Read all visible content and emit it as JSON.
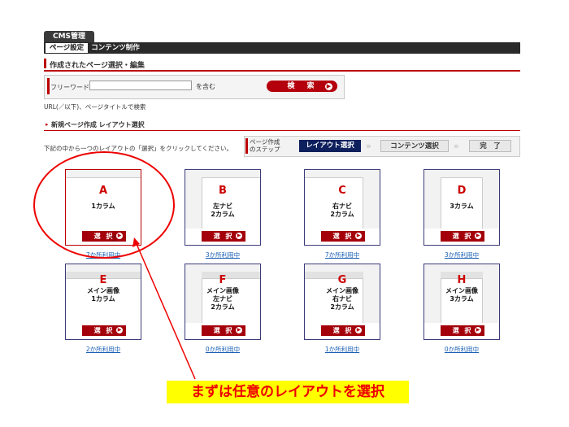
{
  "header": {
    "app_tab": "CMS管理",
    "subtabs": [
      "ページ設定",
      "コンテンツ制作"
    ]
  },
  "section1": {
    "title": "作成されたページ選択・編集"
  },
  "search": {
    "label": "フリーワード",
    "value": "",
    "suffix": "を含む",
    "button": "検　索",
    "hint": "URL(／以下)、ページタイトルで検索"
  },
  "section2": {
    "title": "新規ページ作成 レイアウト選択"
  },
  "instruction": "下記の中から一つのレイアウトの「選択」をクリックしてください。",
  "steps": {
    "label_line1": "ページ作成",
    "label_line2": "のステップ",
    "items": [
      "レイアウト選択",
      "コンテンツ選択",
      "完　了"
    ]
  },
  "layouts": [
    {
      "letter": "A",
      "desc": "1カラム",
      "button": "選 択",
      "usage": "7か所利用中"
    },
    {
      "letter": "B",
      "desc": "左ナビ\n2カラム",
      "button": "選 択",
      "usage": "3か所利用中"
    },
    {
      "letter": "C",
      "desc": "右ナビ\n2カラム",
      "button": "選 択",
      "usage": "7か所利用中"
    },
    {
      "letter": "D",
      "desc": "3カラム",
      "button": "選 択",
      "usage": "3か所利用中"
    },
    {
      "letter": "E",
      "desc": "メイン画像\n1カラム",
      "button": "選 択",
      "usage": "2か所利用中"
    },
    {
      "letter": "F",
      "desc": "メイン画像\n左ナビ\n2カラム",
      "button": "選 択",
      "usage": "0か所利用中"
    },
    {
      "letter": "G",
      "desc": "メイン画像\n右ナビ\n2カラム",
      "button": "選 択",
      "usage": "1か所利用中"
    },
    {
      "letter": "H",
      "desc": "メイン画像\n3カラム",
      "button": "選 択",
      "usage": "0か所利用中"
    }
  ],
  "annotation": "まずは任意のレイアウトを選択",
  "colors": {
    "accent_red": "#b4000c",
    "step_navy": "#0d1f5c",
    "annotation_bg": "#ffff00",
    "link_blue": "#1a5fb4"
  }
}
